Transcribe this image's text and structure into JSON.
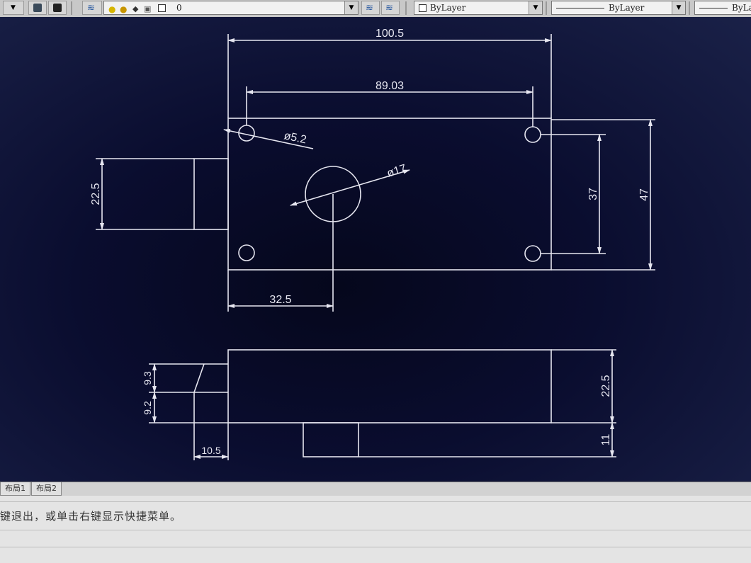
{
  "toolbar": {
    "layer_value": "0",
    "color_value": "ByLayer",
    "linetype_value": "ByLayer",
    "lineweight_value": "ByLa"
  },
  "dimensions": {
    "overall_width": "100.5",
    "hole_spacing": "89.03",
    "small_hole_dia": "ø5.2",
    "large_hole_dia": "ø17",
    "bolt_height": "22.5",
    "hole_vertical_spacing": "37",
    "body_height": "47",
    "center_offset": "32.5",
    "side_upper": "9.3",
    "side_lower": "9.2",
    "side_height": "22.5",
    "base_height": "11",
    "bolt_length": "10.5"
  },
  "layout_tabs": [
    "布局1",
    "布局2"
  ],
  "command": {
    "prompt": "键退出，或单击右键显示快捷菜单。"
  },
  "colors": {
    "background": "#0c0f2e",
    "lines": "#e6e6f0",
    "toolbar": "#c8c8c8"
  }
}
